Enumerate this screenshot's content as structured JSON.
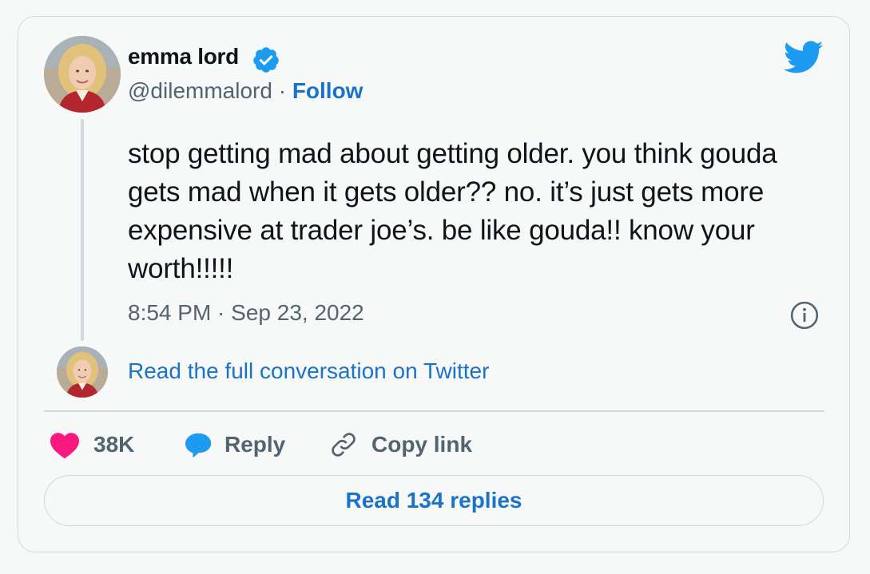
{
  "author": {
    "name": "emma lord",
    "handle": "@dilemmalord",
    "separator": " · ",
    "follow_label": "Follow",
    "verified_icon": "verified-badge-icon"
  },
  "brand": {
    "logo_icon": "twitter-bird-icon",
    "accent_color": "#1d9bf0",
    "link_color": "#1a73c9"
  },
  "tweet": {
    "text": "stop getting mad about getting older. you think gouda gets mad when it gets older?? no. it’s just gets more expensive at trader joe’s. be like gouda!! know your worth!!!!!",
    "timestamp": "8:54 PM · Sep 23, 2022"
  },
  "conversation": {
    "link_label": "Read the full conversation on Twitter"
  },
  "actions": {
    "like_count": "38K",
    "like_color": "#f91880",
    "reply_label": "Reply",
    "copy_link_label": "Copy link"
  },
  "footer": {
    "read_replies_label": "Read 134 replies"
  }
}
